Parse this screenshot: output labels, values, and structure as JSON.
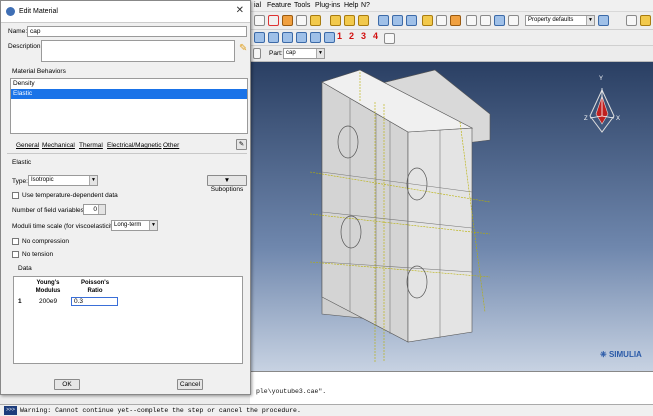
{
  "menubar": {
    "items": [
      "ial",
      "Feature",
      "Tools",
      "Plug-ins",
      "Help",
      "N?"
    ]
  },
  "toolbar": {
    "render_style": "Property defaults",
    "step_numbers": [
      "1",
      "2",
      "3",
      "4"
    ],
    "part_label": "Part:",
    "part_value": "cap"
  },
  "viewport": {
    "brand": "SIMULIA",
    "triad": {
      "y": "Y",
      "z": "Z",
      "x": "X"
    }
  },
  "message_area": {
    "line1": "ple\\youtube3.cae\"."
  },
  "status": {
    "warning": "Warning: Cannot continue yet--complete the step or cancel the procedure."
  },
  "dialog": {
    "title": "Edit Material",
    "name_label": "Name:",
    "name_value": "cap",
    "description_label": "Description:",
    "behaviors_label": "Material Behaviors",
    "behaviors": [
      "Density",
      "Elastic"
    ],
    "tabs": [
      "General",
      "Mechanical",
      "Thermal",
      "Electrical/Magnetic",
      "Other"
    ],
    "section_title": "Elastic",
    "type_label": "Type:",
    "type_value": "Isotropic",
    "suboptions_label": "Suboptions",
    "temp_dep_label": "Use temperature-dependent data",
    "field_vars_label": "Number of field variables:",
    "field_vars_value": "0",
    "moduli_label": "Moduli time scale (for viscoelasticity):",
    "moduli_value": "Long-term",
    "no_compression_label": "No compression",
    "no_tension_label": "No tension",
    "data_label": "Data",
    "col_youngs_line1": "Young's",
    "col_youngs_line2": "Modulus",
    "col_poisson_line1": "Poisson's",
    "col_poisson_line2": "Ratio",
    "row_index": "1",
    "youngs_value": "200e9",
    "poisson_value": "0.3",
    "ok_label": "OK",
    "cancel_label": "Cancel"
  },
  "colors": {
    "selection": "#1a73e8",
    "viewport_top": "#2a3f63",
    "viewport_bottom": "#c7d2e2",
    "step_numbers": "#d21010"
  }
}
